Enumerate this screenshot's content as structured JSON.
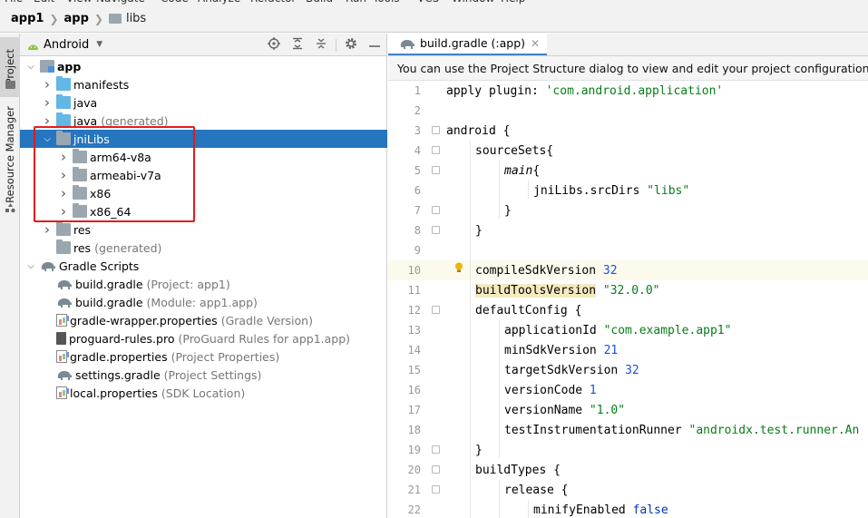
{
  "menubar": [
    "File",
    "Edit",
    "View",
    "Navigate",
    "Code",
    "Analyze",
    "Refactor",
    "Build",
    "Run",
    "Tools",
    "VCS",
    "Window",
    "Help"
  ],
  "breadcrumb": {
    "project": "app1",
    "module": "app",
    "folder": "libs"
  },
  "stripe": {
    "project_tab": "Project",
    "resource_tab": "Resource Manager"
  },
  "panel": {
    "view_selector": "Android"
  },
  "tree": [
    {
      "label": "app",
      "hint": "",
      "depth": 0,
      "expanded": true,
      "icon": "module-icon",
      "bold": true
    },
    {
      "label": "manifests",
      "hint": "",
      "depth": 1,
      "expanded": false,
      "icon": "folder-blue"
    },
    {
      "label": "java",
      "hint": "",
      "depth": 1,
      "expanded": false,
      "icon": "folder-blue"
    },
    {
      "label": "java",
      "hint": "(generated)",
      "depth": 1,
      "expanded": false,
      "icon": "folder-blue"
    },
    {
      "label": "jniLibs",
      "hint": "",
      "depth": 1,
      "expanded": true,
      "icon": "folder-gray",
      "selected": true
    },
    {
      "label": "arm64-v8a",
      "hint": "",
      "depth": 2,
      "expanded": false,
      "icon": "folder-gray"
    },
    {
      "label": "armeabi-v7a",
      "hint": "",
      "depth": 2,
      "expanded": false,
      "icon": "folder-gray"
    },
    {
      "label": "x86",
      "hint": "",
      "depth": 2,
      "expanded": false,
      "icon": "folder-gray"
    },
    {
      "label": "x86_64",
      "hint": "",
      "depth": 2,
      "expanded": false,
      "icon": "folder-gray"
    },
    {
      "label": "res",
      "hint": "",
      "depth": 1,
      "expanded": false,
      "icon": "folder-gray"
    },
    {
      "label": "res",
      "hint": "(generated)",
      "depth": 1,
      "expanded": null,
      "icon": "folder-gray"
    },
    {
      "label": "Gradle Scripts",
      "hint": "",
      "depth": 0,
      "expanded": true,
      "icon": "elephant"
    },
    {
      "label": "build.gradle",
      "hint": "(Project: app1)",
      "depth": 1,
      "expanded": null,
      "icon": "elephant"
    },
    {
      "label": "build.gradle",
      "hint": "(Module: app1.app)",
      "depth": 1,
      "expanded": null,
      "icon": "elephant"
    },
    {
      "label": "gradle-wrapper.properties",
      "hint": "(Gradle Version)",
      "depth": 1,
      "expanded": null,
      "icon": "file-prop"
    },
    {
      "label": "proguard-rules.pro",
      "hint": "(ProGuard Rules for app1.app)",
      "depth": 1,
      "expanded": null,
      "icon": "file-pro"
    },
    {
      "label": "gradle.properties",
      "hint": "(Project Properties)",
      "depth": 1,
      "expanded": null,
      "icon": "file-prop"
    },
    {
      "label": "settings.gradle",
      "hint": "(Project Settings)",
      "depth": 1,
      "expanded": null,
      "icon": "elephant"
    },
    {
      "label": "local.properties",
      "hint": "(SDK Location)",
      "depth": 1,
      "expanded": null,
      "icon": "file-prop"
    }
  ],
  "editor": {
    "tab_label": "build.gradle (:app)",
    "notice": "You can use the Project Structure dialog to view and edit your project configuration",
    "lines": [
      {
        "n": "1",
        "indent": 0,
        "parts": [
          [
            "txt",
            "apply "
          ],
          [
            "kw",
            "plugin"
          ],
          [
            "txt",
            ": "
          ],
          [
            "str",
            "'com.android.application'"
          ]
        ]
      },
      {
        "n": "2",
        "indent": 0,
        "parts": []
      },
      {
        "n": "3",
        "indent": 0,
        "parts": [
          [
            "txt",
            "android {"
          ]
        ],
        "fold": true
      },
      {
        "n": "4",
        "indent": 1,
        "parts": [
          [
            "txt",
            "sourceSets{"
          ]
        ],
        "fold": true
      },
      {
        "n": "5",
        "indent": 2,
        "parts": [
          [
            "ital",
            "main"
          ],
          [
            "txt",
            "{"
          ]
        ],
        "fold": true
      },
      {
        "n": "6",
        "indent": 3,
        "parts": [
          [
            "txt",
            "jniLibs.srcDirs "
          ],
          [
            "str",
            "\"libs\""
          ]
        ]
      },
      {
        "n": "7",
        "indent": 2,
        "parts": [
          [
            "txt",
            "}"
          ]
        ],
        "fold": true
      },
      {
        "n": "8",
        "indent": 1,
        "parts": [
          [
            "txt",
            "}"
          ]
        ],
        "fold": true
      },
      {
        "n": "9",
        "indent": 0,
        "parts": []
      },
      {
        "n": "10",
        "indent": 1,
        "parts": [
          [
            "txt",
            "compileSdkVersion "
          ],
          [
            "num",
            "32"
          ]
        ],
        "current": true,
        "bulb": true
      },
      {
        "n": "11",
        "indent": 1,
        "parts": [
          [
            "sel",
            "buildToolsVersion"
          ],
          [
            "txt",
            " "
          ],
          [
            "str",
            "\"32.0.0\""
          ]
        ]
      },
      {
        "n": "12",
        "indent": 1,
        "parts": [
          [
            "txt",
            "defaultConfig {"
          ]
        ],
        "fold": true
      },
      {
        "n": "13",
        "indent": 2,
        "parts": [
          [
            "txt",
            "applicationId "
          ],
          [
            "str",
            "\"com.example.app1\""
          ]
        ]
      },
      {
        "n": "14",
        "indent": 2,
        "parts": [
          [
            "txt",
            "minSdkVersion "
          ],
          [
            "num",
            "21"
          ]
        ]
      },
      {
        "n": "15",
        "indent": 2,
        "parts": [
          [
            "txt",
            "targetSdkVersion "
          ],
          [
            "num",
            "32"
          ]
        ]
      },
      {
        "n": "16",
        "indent": 2,
        "parts": [
          [
            "txt",
            "versionCode "
          ],
          [
            "num",
            "1"
          ]
        ]
      },
      {
        "n": "17",
        "indent": 2,
        "parts": [
          [
            "txt",
            "versionName "
          ],
          [
            "str",
            "\"1.0\""
          ]
        ]
      },
      {
        "n": "18",
        "indent": 2,
        "parts": [
          [
            "txt",
            "testInstrumentationRunner "
          ],
          [
            "str",
            "\"androidx.test.runner.An"
          ]
        ]
      },
      {
        "n": "19",
        "indent": 1,
        "parts": [
          [
            "txt",
            "}"
          ]
        ],
        "fold": true
      },
      {
        "n": "20",
        "indent": 1,
        "parts": [
          [
            "txt",
            "buildTypes {"
          ]
        ],
        "fold": true
      },
      {
        "n": "21",
        "indent": 2,
        "parts": [
          [
            "txt",
            "release {"
          ]
        ],
        "fold": true
      },
      {
        "n": "22",
        "indent": 3,
        "parts": [
          [
            "txt",
            "minifyEnabled "
          ],
          [
            "kwb",
            "false"
          ]
        ]
      }
    ]
  },
  "colors": {
    "selection": "#2675bf",
    "highlight_box": "#e41b1b",
    "string": "#067d17",
    "number": "#1750eb",
    "keyword": "#0033b3"
  }
}
